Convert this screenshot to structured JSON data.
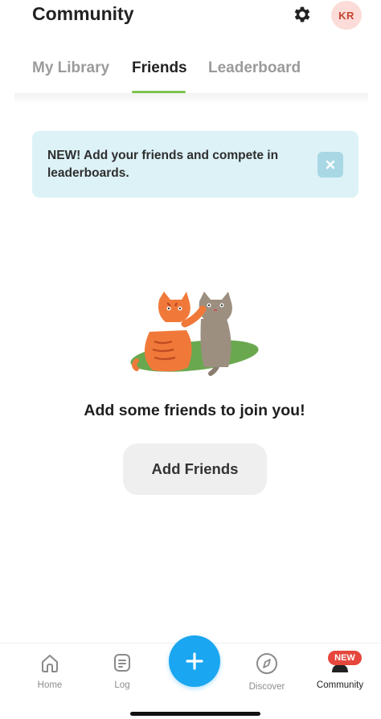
{
  "header": {
    "title": "Community",
    "avatar_initials": "KR",
    "settings_icon": "gear-icon"
  },
  "tabs": [
    {
      "label": "My Library",
      "active": false
    },
    {
      "label": "Friends",
      "active": true
    },
    {
      "label": "Leaderboard",
      "active": false
    }
  ],
  "banner": {
    "text": "NEW! Add your friends and compete in leaderboards.",
    "close_icon": "close-icon"
  },
  "empty_state": {
    "illustration": "two-cats-illustration",
    "message": "Add some friends to join you!",
    "button_label": "Add Friends"
  },
  "bottom_nav": {
    "items": [
      {
        "label": "Home",
        "icon": "home-icon",
        "active": false
      },
      {
        "label": "Log",
        "icon": "log-icon",
        "active": false
      },
      {
        "label": "Discover",
        "icon": "compass-icon",
        "active": false
      },
      {
        "label": "Community",
        "icon": "community-icon",
        "active": true,
        "badge": "NEW"
      }
    ],
    "fab_icon": "plus-icon"
  },
  "colors": {
    "accent_green": "#7dc44f",
    "banner_bg": "#dcf2f7",
    "fab_blue": "#1aa6f0",
    "badge_red": "#e6463c",
    "avatar_bg": "#fbdcd8"
  }
}
